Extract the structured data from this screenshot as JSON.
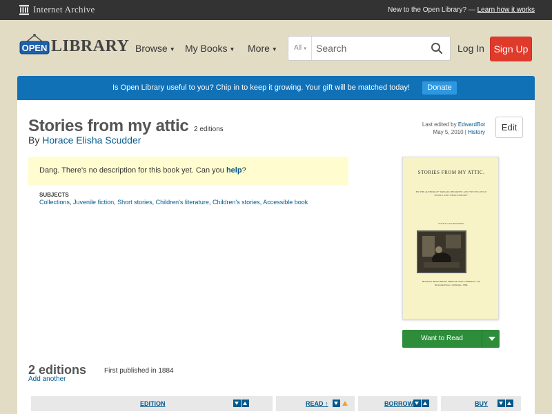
{
  "ia_bar": {
    "logo_text": "Internet Archive",
    "new_text": "New to the Open Library? —",
    "learn_link": "Learn how it works"
  },
  "header": {
    "logo_open": "OPEN",
    "logo_library": "LIBRARY",
    "nav": [
      {
        "label": "Browse"
      },
      {
        "label": "My Books"
      },
      {
        "label": "More"
      }
    ],
    "search": {
      "scope": "All",
      "placeholder": "Search"
    },
    "login_label": "Log In",
    "signup_label": "Sign Up"
  },
  "banner": {
    "text": "Is Open Library useful to you? Chip in to keep it growing. Your gift will be matched today!",
    "donate_label": "Donate"
  },
  "book": {
    "title": "Stories from my attic",
    "editions_count": "2 editions",
    "by_prefix": "By",
    "author": "Horace Elisha Scudder",
    "last_edited_prefix": "Last edited by",
    "last_edited_by": "EdwardBot",
    "last_edited_date": "May 5, 2010",
    "history_link": "History",
    "edit_label": "Edit",
    "description_text": "Dang. There's no description for this book yet. Can you",
    "description_help": "help",
    "description_suffix": "?",
    "subjects_label": "SUBJECTS",
    "subjects": [
      "Collections",
      "Juvenile fiction",
      "Short stories",
      "Children's literature",
      "Children's stories",
      "Accessible book"
    ],
    "cover": {
      "title": "STORIES FROM MY ATTIC.",
      "author_line": "BY THE AUTHOR OF \"DREAM CHILDREN\" AND \"SEVEN LITTLE PEOPLE AND THEIR FRIENDS\"",
      "illustrations": "WITH ILLUSTRATIONS.",
      "publisher": "BOSTON: HOUGHTON, MIFFLIN AND COMPANY. The Riverside Press, Cambridge. 1884."
    },
    "want_to_read": "Want to Read"
  },
  "editions": {
    "heading": "2 editions",
    "first_published": "First published in 1884",
    "add_another": "Add another",
    "columns": [
      {
        "label": "EDITION"
      },
      {
        "label": "READ ↑"
      },
      {
        "label": "BORROW"
      },
      {
        "label": "BUY"
      }
    ]
  },
  "colors": {
    "ia_bar": "#333333",
    "page_bg": "#e2dcc5",
    "banner": "#1171b7",
    "donate": "#2d98e0",
    "signup": "#e03a2b",
    "want_to_read": "#2d8d3a",
    "link": "#02598b",
    "description_bg": "#fffdd0"
  }
}
